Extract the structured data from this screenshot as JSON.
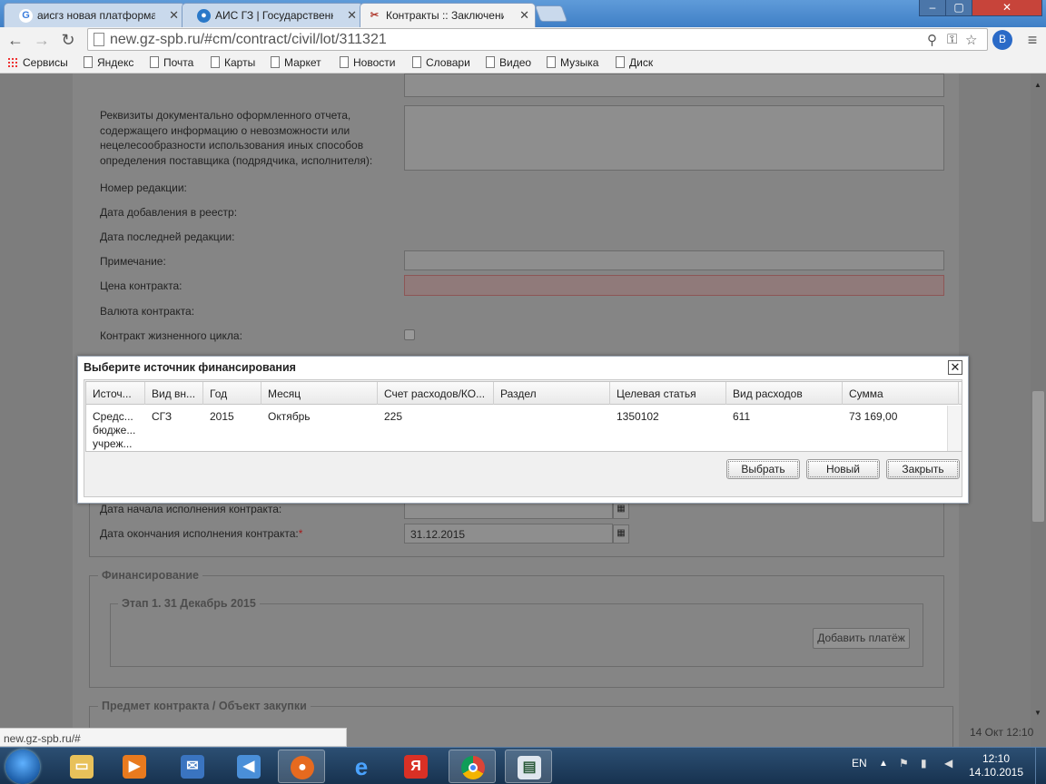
{
  "browser": {
    "tabs": [
      {
        "title": "аисгз новая платформа -",
        "icon": "google-icon"
      },
      {
        "title": "АИС ГЗ | Государственны",
        "icon": "globe-icon"
      },
      {
        "title": "Контракты :: Заключение",
        "icon": "tools-icon",
        "active": true
      }
    ],
    "url": "new.gz-spb.ru/#cm/contract/civil/lot/311321",
    "bookmarks": [
      "Сервисы",
      "Яндекс",
      "Почта",
      "Карты",
      "Маркет",
      "Новости",
      "Словари",
      "Видео",
      "Музыка",
      "Диск"
    ]
  },
  "form": {
    "report_label": "Реквизиты документально оформленного отчета, содержащего информацию о невозможности или нецелесообразности использования иных способов определения поставщика (подрядчика, исполнителя):",
    "edition_number_label": "Номер редакции:",
    "registry_date_label": "Дата добавления в реестр:",
    "last_edition_date_label": "Дата последней редакции:",
    "note_label": "Примечание:",
    "price_label": "Цена контракта:",
    "currency_label": "Валюта контракта:",
    "lifecycle_label": "Контракт жизненного цикла:",
    "start_date_label": "Дата начала исполнения контракта:",
    "end_date_label": "Дата окончания исполнения контракта:",
    "required_mark": "*",
    "end_date_value": "31.12.2015",
    "financing_legend": "Финансирование",
    "stage_legend": "Этап 1. 31 Декабрь 2015",
    "add_payment_label": "Добавить платёж",
    "subject_legend": "Предмет контракта / Объект закупки"
  },
  "modal": {
    "title": "Выберите источник финансирования",
    "close_symbol": "✕",
    "columns": [
      "Источ...",
      "Вид вн...",
      "Год",
      "Месяц",
      "Счет расходов/КО...",
      "Раздел",
      "Целевая статья",
      "Вид расходов",
      "Сумма"
    ],
    "rows": [
      {
        "source_lines": [
          "Средс...",
          "бюдже...",
          "учреж..."
        ],
        "type": "СГЗ",
        "year": "2015",
        "month": "Октябрь",
        "account": "225",
        "section": "",
        "target": "1350102",
        "expense_type": "611",
        "amount": "73 169,00"
      }
    ],
    "buttons": {
      "select": "Выбрать",
      "new": "Новый",
      "close": "Закрыть"
    }
  },
  "status": {
    "hover_url": "new.gz-spb.ru/#",
    "page_clock": "14 Окт 12:10"
  },
  "taskbar": {
    "lang": "EN",
    "time": "12:10",
    "date": "14.10.2015"
  }
}
